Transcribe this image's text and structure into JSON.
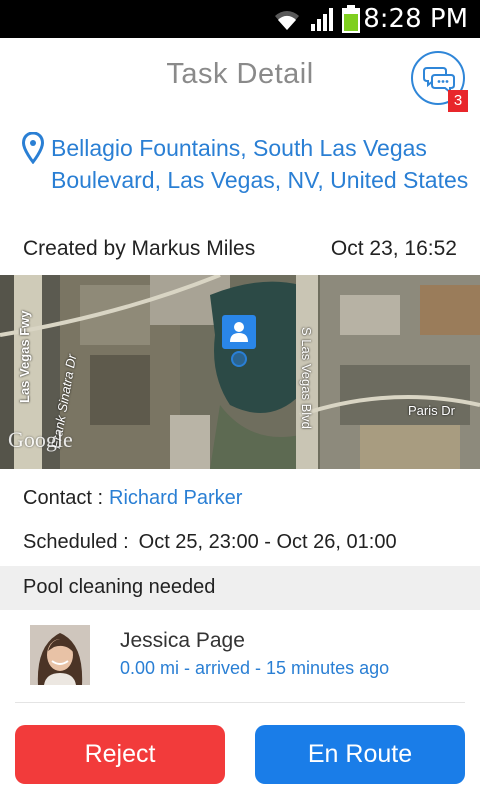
{
  "status_bar": {
    "time": "8:28 PM"
  },
  "header": {
    "title": "Task Detail",
    "chat_badge": "3"
  },
  "task": {
    "address": "Bellagio Fountains, South Las Vegas Boulevard, Las Vegas, NV, United States",
    "created_by": "Created by Markus Miles",
    "created_date": "Oct 23, 16:52",
    "contact_label": "Contact :",
    "contact_name": "Richard Parker",
    "scheduled_label": "Scheduled :",
    "scheduled_value": "Oct 25, 23:00 - Oct 26, 01:00",
    "note": "Pool cleaning needed"
  },
  "map": {
    "street_labels": [
      "Las Vegas Fwy",
      "Frank Sinatra Dr",
      "S Las Vegas Blvd",
      "Paris Dr"
    ],
    "brand": "Google"
  },
  "assignee": {
    "name": "Jessica Page",
    "eta": "0.00 mi - arrived - 15 minutes ago"
  },
  "actions": {
    "reject_label": "Reject",
    "enroute_label": "En Route"
  },
  "colors": {
    "accent": "#2a7fd4",
    "reject": "#f23b3b",
    "enroute": "#1a7de8",
    "badge": "#e8262b"
  },
  "icons": [
    "wifi-icon",
    "signal-icon",
    "battery-icon",
    "chat-icon",
    "location-pin-icon",
    "user-marker-icon"
  ]
}
